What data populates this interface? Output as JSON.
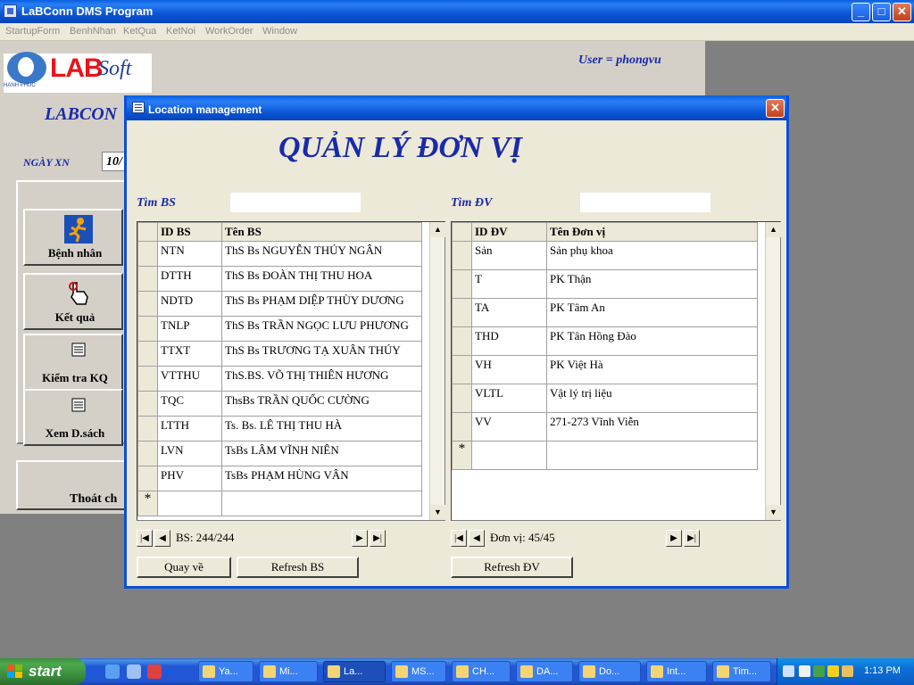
{
  "window": {
    "title": "LaBConn DMS Program",
    "controls": {
      "minimize": "_",
      "maximize": "□",
      "close": "✕"
    }
  },
  "menu": [
    "StartupForm",
    "BenhNhan",
    "KetQua",
    "KetNoi",
    "WorkOrder",
    "Window"
  ],
  "background_form": {
    "logo_lab": "LAB",
    "logo_soft": "Soft",
    "logo_sub": "HANH PHUC",
    "user": "User = phongvu",
    "title_partial": "LABCON",
    "date_label": "NGÀY XN",
    "date_value": "10/",
    "nav_buttons": [
      "Bệnh nhân",
      "Kết quả",
      "Kiểm tra KQ",
      "Xem D.sách"
    ],
    "exit_partial": "Thoát ch"
  },
  "dialog": {
    "title": "Location management",
    "heading": "QUẢN LÝ ĐƠN VỊ",
    "search_bs_label": "Tìm BS",
    "search_dv_label": "Tìm ĐV",
    "search_bs_value": "",
    "search_dv_value": "",
    "bs_grid": {
      "columns": [
        "ID BS",
        "Tên BS"
      ],
      "rows": [
        [
          "NTN",
          "ThS Bs NGUYỄN THÚY NGÂN"
        ],
        [
          "DTTH",
          "ThS Bs ĐOÀN THỊ THU HOA"
        ],
        [
          "NDTD",
          "ThS Bs PHẠM DIỆP THÙY DƯƠNG"
        ],
        [
          "TNLP",
          "ThS Bs TRẦN NGỌC LƯU PHƯƠNG"
        ],
        [
          "TTXT",
          "ThS Bs TRƯƠNG TẠ XUÂN THÚY"
        ],
        [
          "VTTHU",
          "ThS.BS. VÕ THỊ THIÊN HƯƠNG"
        ],
        [
          "TQC",
          "ThsBs TRẦN QUỐC CƯỜNG"
        ],
        [
          "LTTH",
          "Ts. Bs. LÊ THỊ THU HÀ"
        ],
        [
          "LVN",
          "TsBs LÂM VĨNH NIÊN"
        ],
        [
          "PHV",
          "TsBs PHẠM HÙNG VÂN"
        ]
      ],
      "new_row_marker": "*",
      "record_label": "BS: 244/244"
    },
    "dv_grid": {
      "columns": [
        "ID ĐV",
        "Tên Đơn vị"
      ],
      "rows": [
        [
          "Sản",
          "Sản phụ khoa"
        ],
        [
          "T",
          "PK Thận"
        ],
        [
          "TA",
          "PK Tâm An"
        ],
        [
          "THD",
          "PK Tân Hồng Đào"
        ],
        [
          "VH",
          "PK Việt Hà"
        ],
        [
          "VLTL",
          "Vật lý trị liệu"
        ],
        [
          "VV",
          "271-273 Vĩnh Viễn"
        ]
      ],
      "new_row_marker": "*",
      "record_label": "Đơn vị: 45/45"
    },
    "buttons": {
      "back": "Quay về",
      "refresh_bs": "Refresh BS",
      "refresh_dv": "Refresh ĐV"
    },
    "close": "✕"
  },
  "taskbar": {
    "start": "start",
    "tasks": [
      "Ya...",
      "Mi...",
      "La...",
      "MS...",
      "CH...",
      "DA...",
      "Do...",
      "Int...",
      "Tim..."
    ],
    "clock": "1:13 PM"
  }
}
